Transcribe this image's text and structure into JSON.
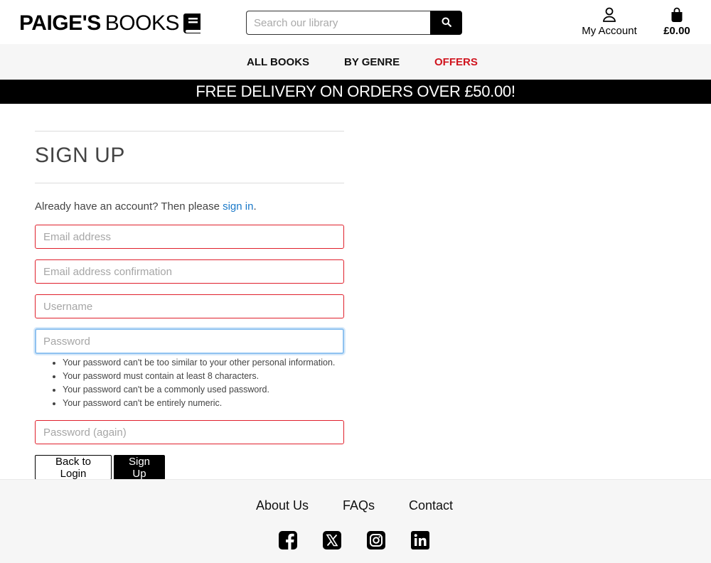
{
  "header": {
    "logo_bold": "PAIGE'S",
    "logo_light": "BOOKS",
    "search_placeholder": "Search our library",
    "account_label": "My Account",
    "bag_total": "£0.00"
  },
  "nav": {
    "items": [
      {
        "label": "ALL BOOKS"
      },
      {
        "label": "BY GENRE"
      },
      {
        "label": "OFFERS",
        "color": "#d0141e"
      }
    ]
  },
  "banner": {
    "text": "FREE DELIVERY ON ORDERS OVER £50.00!"
  },
  "signup": {
    "title": "SIGN UP",
    "intro_text": "Already have an account? Then please ",
    "intro_link": "sign in",
    "intro_end": ".",
    "fields": {
      "email_placeholder": "Email address",
      "email_confirm_placeholder": "Email address confirmation",
      "username_placeholder": "Username",
      "password_placeholder": "Password",
      "password_again_placeholder": "Password (again)"
    },
    "password_help": [
      "Your password can't be too similar to your other personal information.",
      "Your password must contain at least 8 characters.",
      "Your password can't be a commonly used password.",
      "Your password can't be entirely numeric."
    ],
    "back_button": "Back to Login",
    "submit_button": "Sign Up"
  },
  "footer": {
    "links": [
      "About Us",
      "FAQs",
      "Contact"
    ],
    "social_icons": [
      "facebook-icon",
      "x-icon",
      "instagram-icon",
      "linkedin-icon"
    ]
  },
  "colors": {
    "accent_red": "#d0141e",
    "link_blue": "#1a79c9",
    "error_border": "#e0202c",
    "focus_border": "#8fc2f0"
  }
}
